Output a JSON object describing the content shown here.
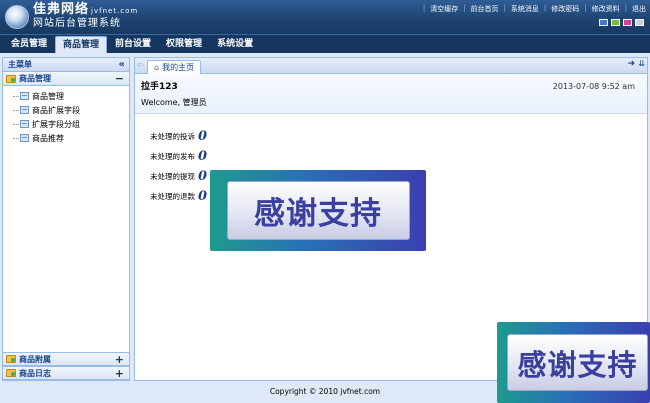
{
  "header": {
    "brand_name": "佳弗网络",
    "brand_domain": "jvfnet.com",
    "brand_subtitle": "网站后台管理系统",
    "top_links": [
      "清空缓存",
      "前台首页",
      "系统消息",
      "修改密码",
      "修改资料",
      "退出"
    ],
    "skin_colors": [
      "#3a7ad8",
      "#6fbf3a",
      "#e03aa0",
      "#d0d0d0"
    ]
  },
  "nav": {
    "items": [
      "会员管理",
      "商品管理",
      "前台设置",
      "权限管理",
      "系统设置"
    ],
    "active_index": 1
  },
  "sidebar": {
    "title": "主菜单",
    "collapse_symbol": "«",
    "expanded_group": {
      "label": "商品管理",
      "toggle": "−",
      "items": [
        "商品管理",
        "商品扩展字段",
        "扩展字段分组",
        "商品推荐"
      ]
    },
    "collapsed_groups": [
      {
        "label": "商品附属",
        "toggle": "+"
      },
      {
        "label": "商品日志",
        "toggle": "+"
      }
    ]
  },
  "main": {
    "tab_label": "我的主页",
    "user_name": "拉手123",
    "welcome_text": "Welcome, 管理员",
    "datetime": "2013-07-08 9:52 am",
    "stats": [
      {
        "label": "未处理的投诉",
        "value": "0"
      },
      {
        "label": "未处理的发布",
        "value": "0"
      },
      {
        "label": "未处理的提现",
        "value": "0"
      },
      {
        "label": "未处理的退款",
        "value": "0"
      }
    ]
  },
  "footer": {
    "copyright": "Copyright © 2010 jvfnet.com"
  },
  "promos": [
    "感谢支持",
    "感谢支持"
  ]
}
